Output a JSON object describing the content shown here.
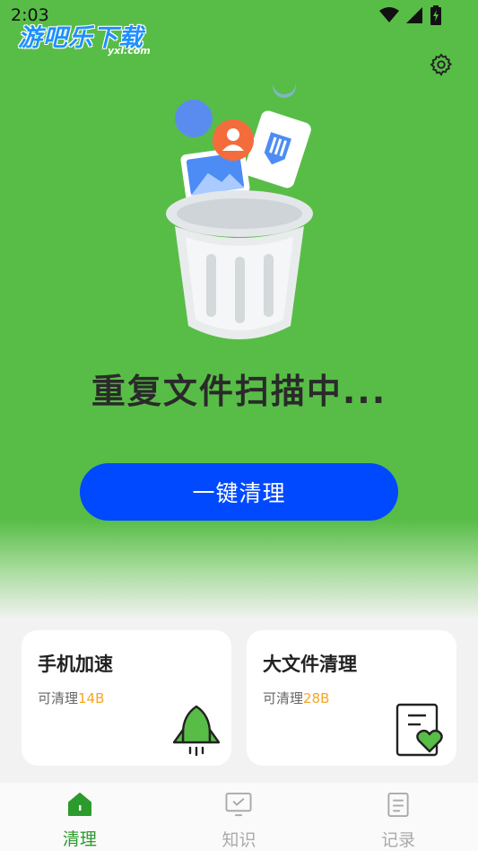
{
  "status_bar": {
    "time": "2:03"
  },
  "watermark": {
    "text": "游吧乐下载",
    "sub": "yxl.com"
  },
  "header": {
    "settings_icon": "gear-icon"
  },
  "main": {
    "scan_status": "重复文件扫描中...",
    "clean_button": "一键清理"
  },
  "cards": [
    {
      "title": "手机加速",
      "sub_label": "可清理",
      "amount": "14B",
      "icon": "rocket-icon"
    },
    {
      "title": "大文件清理",
      "sub_label": "可清理",
      "amount": "28B",
      "icon": "file-heart-icon"
    }
  ],
  "tabs": [
    {
      "label": "清理",
      "icon": "home-icon",
      "active": true
    },
    {
      "label": "知识",
      "icon": "monitor-check-icon",
      "active": false
    },
    {
      "label": "记录",
      "icon": "document-icon",
      "active": false
    }
  ],
  "colors": {
    "brand_green": "#58bd47",
    "button_blue": "#0049ff",
    "amount_orange": "#f5a623",
    "tab_active": "#2c9a2c"
  }
}
